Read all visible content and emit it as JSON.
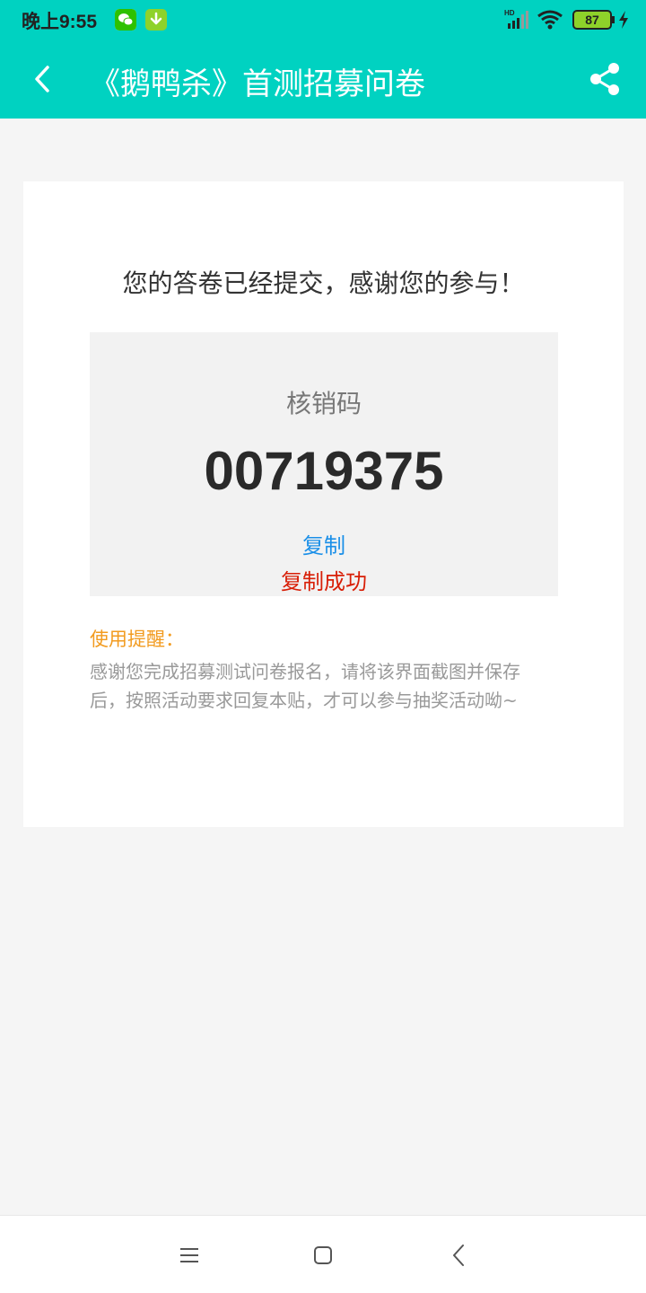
{
  "status_bar": {
    "time": "晚上9:55",
    "battery": "87",
    "icons": [
      "wechat-icon",
      "download-icon",
      "hd-signal-icon",
      "wifi-icon",
      "battery-icon",
      "charging-icon"
    ]
  },
  "app_bar": {
    "title": "《鹅鸭杀》首测招募问卷",
    "back_icon": "chevron-left-icon",
    "share_icon": "share-icon",
    "color": "#00d2c1"
  },
  "card": {
    "thanks_text": "您的答卷已经提交，感谢您的参与！",
    "code_label": "核销码",
    "code_value": "00719375",
    "copy_label": "复制",
    "copy_success": "复制成功",
    "tip_title": "使用提醒：",
    "tip_body": "感谢您完成招募测试问卷报名，请将该界面截图并保存后，按照活动要求回复本贴，才可以参与抽奖活动呦~"
  },
  "nav_bar": {
    "icons": [
      "menu-icon",
      "home-icon",
      "back-icon"
    ]
  }
}
